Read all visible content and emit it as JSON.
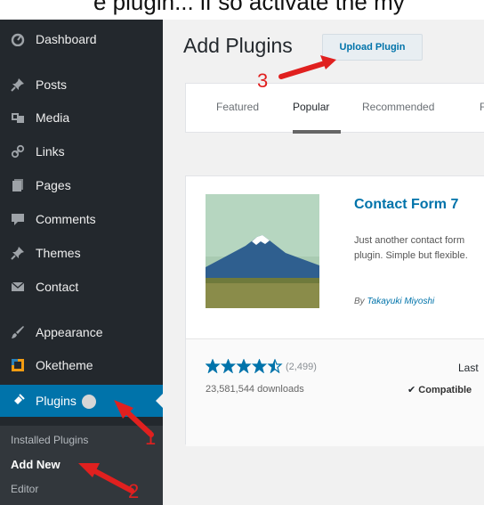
{
  "caption": "e plugin... if so activate the my",
  "sidebar": {
    "items": [
      {
        "label": "Dashboard",
        "icon": "dashboard-icon"
      },
      {
        "label": "Posts",
        "icon": "pushpin-icon"
      },
      {
        "label": "Media",
        "icon": "media-icon"
      },
      {
        "label": "Links",
        "icon": "link-icon"
      },
      {
        "label": "Pages",
        "icon": "pages-icon"
      },
      {
        "label": "Comments",
        "icon": "comment-icon"
      },
      {
        "label": "Themes",
        "icon": "pushpin-icon"
      },
      {
        "label": "Contact",
        "icon": "mail-icon"
      },
      {
        "label": "Appearance",
        "icon": "brush-icon"
      },
      {
        "label": "Oketheme",
        "icon": "theme-square-icon"
      },
      {
        "label": "Plugins",
        "icon": "plugin-icon"
      }
    ],
    "submenu": [
      "Installed Plugins",
      "Add New",
      "Editor"
    ]
  },
  "main": {
    "title": "Add Plugins",
    "upload_button": "Upload Plugin",
    "tabs": [
      "Featured",
      "Popular",
      "Recommended",
      "F"
    ],
    "active_tab": "Popular"
  },
  "plugin": {
    "name": "Contact Form 7",
    "description": "Just another contact form plugin. Simple but flexible.",
    "author_prefix": "By ",
    "author": "Takayuki Miyoshi",
    "rating_stars": 4.5,
    "rating_count": "(2,499)",
    "downloads": "23,581,544 downloads",
    "last_updated": "Last",
    "compatible": "Compatible"
  },
  "annotations": [
    "1",
    "2",
    "3"
  ],
  "colors": {
    "sidebar_bg": "#23282d",
    "active_bg": "#0073aa",
    "link": "#0073aa",
    "annotation": "#e0201f"
  }
}
